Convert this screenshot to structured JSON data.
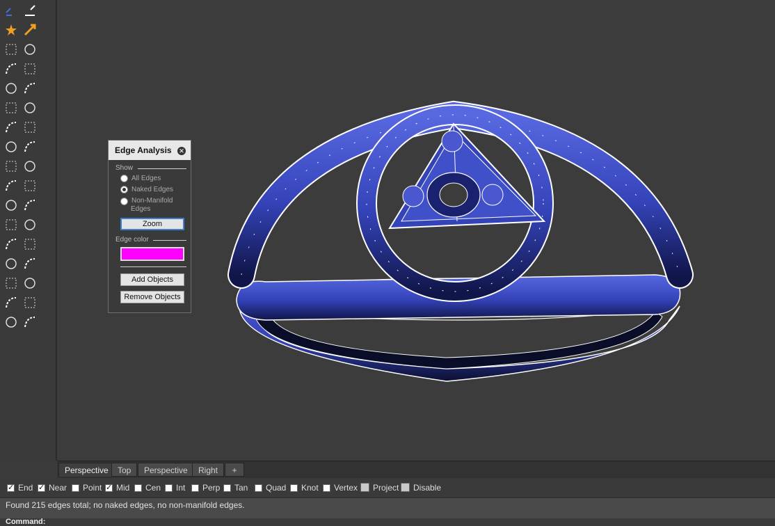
{
  "panel": {
    "title": "Edge Analysis",
    "show_label": "Show",
    "options": [
      "All Edges",
      "Naked Edges",
      "Non-Manifold Edges"
    ],
    "selected_option": "Naked Edges",
    "zoom_label": "Zoom",
    "edge_color_label": "Edge color",
    "edge_color": "#ff00ff",
    "add_objects_label": "Add Objects",
    "remove_objects_label": "Remove Objects"
  },
  "tabs": [
    {
      "label": "Perspective",
      "active": true
    },
    {
      "label": "Top",
      "active": false
    },
    {
      "label": "Perspective",
      "active": false
    },
    {
      "label": "Right",
      "active": false
    },
    {
      "label": "+",
      "active": false
    }
  ],
  "osnaps": [
    {
      "label": "End",
      "checked": true
    },
    {
      "label": "Near",
      "checked": true
    },
    {
      "label": "Point",
      "checked": false
    },
    {
      "label": "Mid",
      "checked": true
    },
    {
      "label": "Cen",
      "checked": false
    },
    {
      "label": "Int",
      "checked": false
    },
    {
      "label": "Perp",
      "checked": false
    },
    {
      "label": "Tan",
      "checked": false
    },
    {
      "label": "Quad",
      "checked": false
    },
    {
      "label": "Knot",
      "checked": false
    },
    {
      "label": "Vertex",
      "checked": false
    },
    {
      "label": "Project",
      "checked": false
    },
    {
      "label": "Disable",
      "checked": false
    }
  ],
  "command_history": "Found 215 edges total; no naked edges, no non-manifold edges.",
  "command_prompt": "Command:",
  "colors": {
    "model_blue": "#3846b8",
    "viewport_bg": "#3c3c3c"
  },
  "toolbar_icons": [
    "point-icon",
    "point-cloud-icon",
    "star-icon",
    "edit-points-icon",
    "select-window-icon",
    "select-crossing-icon",
    "curve-icon",
    "control-points-icon",
    "arc-icon",
    "circle-3pt-icon",
    "polyline-icon",
    "polyline-edit-icon",
    "fillet-icon",
    "blend-icon",
    "gumball-icon",
    "snap-icon",
    "circle-icon",
    "rotate-icon",
    "circle-tangent-icon",
    "analyze-icon",
    "trim-icon",
    "split-icon",
    "explode-icon",
    "join-icon",
    "move-icon",
    "copy-icon",
    "rectangle-icon",
    "box-icon",
    "cylinder-icon",
    "axis-icon",
    "sphere-icon",
    "transform-icon",
    "cage-icon",
    "sparkle-icon"
  ]
}
